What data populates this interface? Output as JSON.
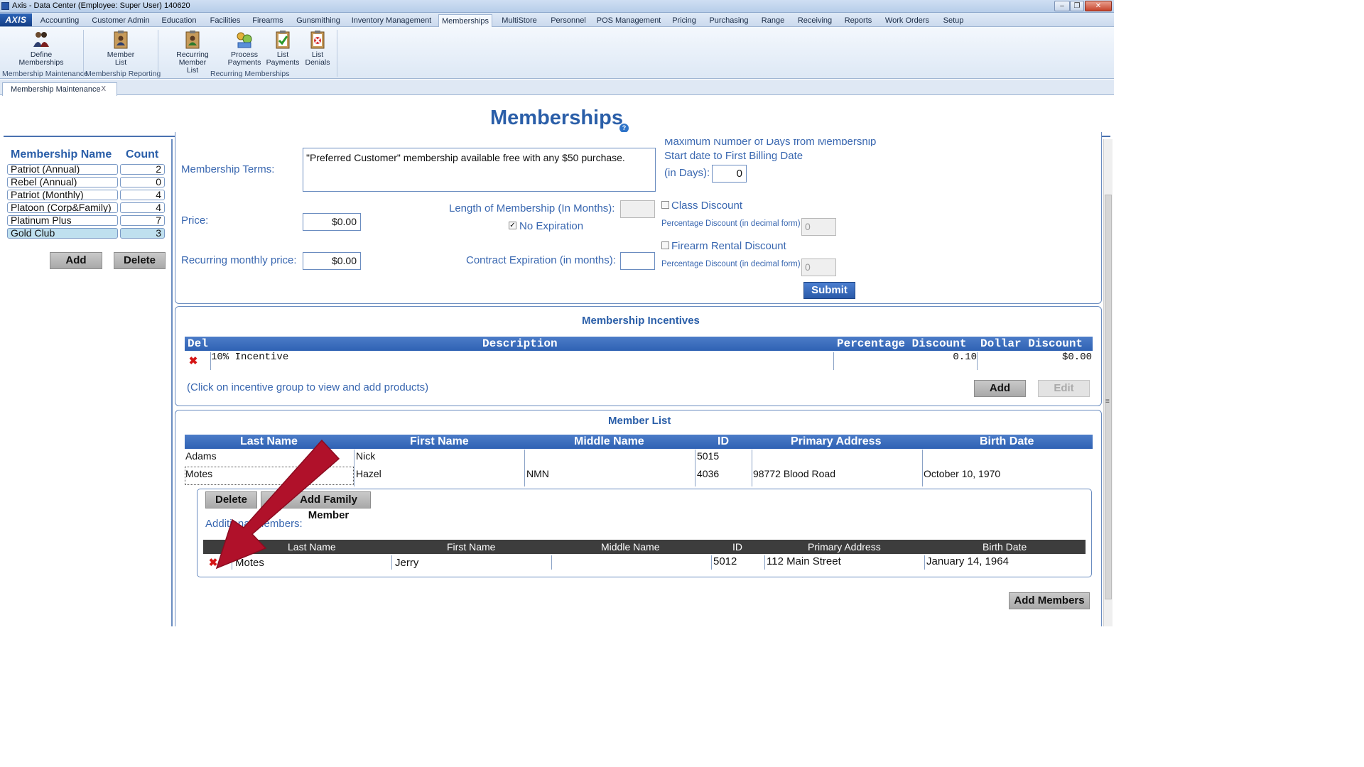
{
  "window": {
    "title": "Axis - Data Center  (Employee: Super User) 140620",
    "min": "–",
    "restore": "❐",
    "close": "✕"
  },
  "menu": {
    "logo": "AXIS",
    "tabs": [
      "Accounting",
      "Customer Admin",
      "Education",
      "Facilities",
      "Firearms",
      "Gunsmithing",
      "Inventory Management",
      "Memberships",
      "MultiStore",
      "Personnel",
      "POS Management",
      "Pricing",
      "Purchasing",
      "Range",
      "Receiving",
      "Reports",
      "Work Orders",
      "Setup"
    ],
    "active": "Memberships"
  },
  "ribbon": {
    "buttons": [
      {
        "label1": "Define",
        "label2": "Memberships",
        "icon": "people-icon"
      },
      {
        "label1": "Member",
        "label2": "List",
        "icon": "clipboard-person-icon"
      },
      {
        "label1": "Recurring Member",
        "label2": "List",
        "icon": "clipboard-recurring-icon"
      },
      {
        "label1": "Process",
        "label2": "Payments",
        "icon": "payments-icon"
      },
      {
        "label1": "List",
        "label2": "Payments",
        "icon": "clipboard-check-icon"
      },
      {
        "label1": "List",
        "label2": "Denials",
        "icon": "clipboard-deny-icon"
      }
    ],
    "groups": [
      "Membership Maintenance",
      "Membership Reporting",
      "Recurring Memberships"
    ]
  },
  "doc_tab": {
    "label": "Membership Maintenance",
    "close": "X"
  },
  "page": {
    "title": "Memberships",
    "help": "?"
  },
  "memberships": {
    "header_name": "Membership Name",
    "header_count": "Count",
    "items": [
      {
        "name": "Patriot (Annual)",
        "count": "2"
      },
      {
        "name": "Rebel (Annual)",
        "count": "0"
      },
      {
        "name": "Patriot (Monthly)",
        "count": "4"
      },
      {
        "name": "Platoon (Corp&Family)",
        "count": "4"
      },
      {
        "name": "Platinum Plus",
        "count": "7"
      },
      {
        "name": "Gold Club",
        "count": "3"
      }
    ],
    "selected": "Gold Club",
    "add_label": "Add",
    "delete_label": "Delete"
  },
  "form": {
    "terms_label": "Membership Terms:",
    "terms_value": "\"Preferred Customer\" membership available free with any $50 purchase.",
    "price_label": "Price:",
    "price_value": "$0.00",
    "recurring_label": "Recurring monthly price:",
    "recurring_value": "$0.00",
    "length_label": "Length of Membership (In Months):",
    "length_value": "",
    "no_expiration_label": "No Expiration",
    "no_expiration_checked": true,
    "contract_label": "Contract Expiration (in months):",
    "contract_value": "",
    "maxdays_line1": "Maximum Number of Days from Membership",
    "maxdays_line2": "Start date to First Billing Date",
    "maxdays_line3": "(in Days):",
    "maxdays_value": "0",
    "class_discount_label": "Class Discount",
    "class_pct_label": "Percentage Discount (in decimal form)",
    "class_pct_value": "0",
    "rental_discount_label": "Firearm Rental Discount",
    "rental_pct_label": "Percentage Discount (in decimal form)",
    "rental_pct_value": "0",
    "submit_label": "Submit"
  },
  "incentives": {
    "title": "Membership Incentives",
    "headers": {
      "del": "Del",
      "description": "Description",
      "pct": "Percentage Discount",
      "dollar": "Dollar Discount"
    },
    "rows": [
      {
        "description": "10% Incentive",
        "pct": "0.10",
        "dollar": "$0.00"
      }
    ],
    "hint": "(Click on incentive group to view and add products)",
    "add_label": "Add",
    "edit_label": "Edit"
  },
  "member_list": {
    "title": "Member List",
    "headers": [
      "Last Name",
      "First Name",
      "Middle Name",
      "ID",
      "Primary Address",
      "Birth Date"
    ],
    "rows": [
      {
        "last": "Adams",
        "first": "Nick",
        "middle": "",
        "id": "5015",
        "address": "",
        "birth": ""
      },
      {
        "last": "Motes",
        "first": "Hazel",
        "middle": "NMN",
        "id": "4036",
        "address": "98772 Blood Road",
        "birth": "October 10, 1970"
      }
    ],
    "delete_label": "Delete",
    "add_family_label": "Add Family Member",
    "additional_label": "Additional Members:",
    "additional_headers": [
      "Last Name",
      "First Name",
      "Middle Name",
      "ID",
      "Primary Address",
      "Birth Date"
    ],
    "additional_rows": [
      {
        "last": "Motes",
        "first": "Jerry",
        "middle": "",
        "id": "5012",
        "address": "112 Main Street",
        "birth": "January 14, 1964"
      }
    ],
    "add_members_label": "Add Members"
  },
  "colors": {
    "accent": "#2a5ea8",
    "header_blue": "#2f62b4",
    "arrow": "#c8102e",
    "delete_red": "#d51515"
  }
}
